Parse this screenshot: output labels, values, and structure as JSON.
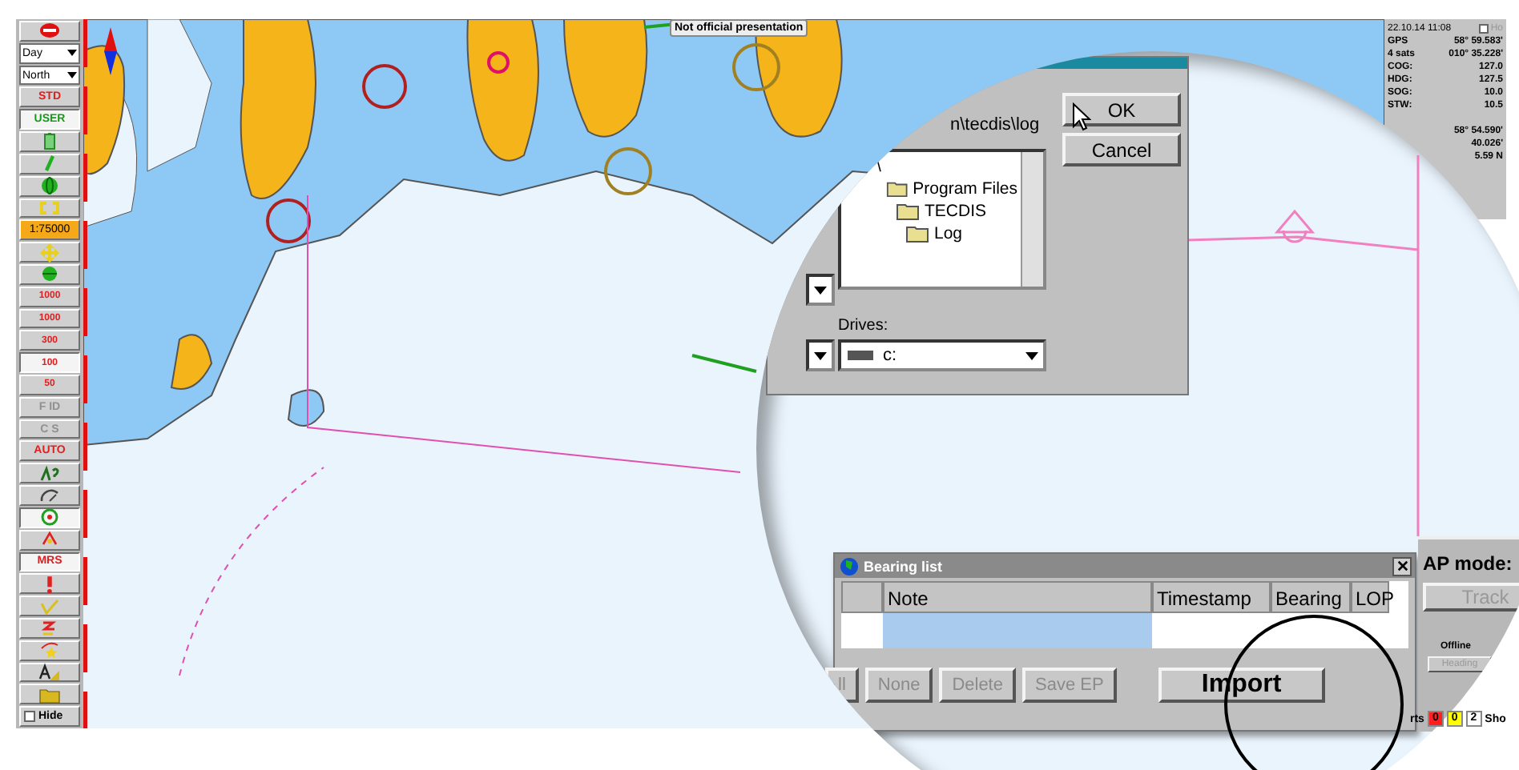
{
  "toolbar": {
    "items": [
      {
        "kind": "icon",
        "selected": false
      },
      {
        "kind": "select",
        "value": "Day",
        "selected": false
      },
      {
        "kind": "select",
        "value": "North",
        "selected": false
      },
      {
        "kind": "text",
        "label": "STD",
        "color": "#e02020",
        "selected": false
      },
      {
        "kind": "text",
        "label": "USER",
        "color": "#1a9a1a",
        "selected": true
      },
      {
        "kind": "icon",
        "selected": false
      },
      {
        "kind": "icon",
        "selected": false
      },
      {
        "kind": "icon",
        "selected": false
      },
      {
        "kind": "icon",
        "selected": false
      },
      {
        "kind": "scale",
        "label": "1:75000",
        "selected": false
      },
      {
        "kind": "icon",
        "selected": false
      },
      {
        "kind": "icon",
        "selected": false
      },
      {
        "kind": "tag",
        "label": "1000",
        "selected": false
      },
      {
        "kind": "tag",
        "label": "1000",
        "selected": false
      },
      {
        "kind": "tag",
        "label": "300",
        "selected": false
      },
      {
        "kind": "tag",
        "label": "100",
        "selected": true
      },
      {
        "kind": "tag",
        "label": "50",
        "selected": false
      },
      {
        "kind": "text",
        "label": "F ID",
        "color": "#909090",
        "selected": false
      },
      {
        "kind": "text",
        "label": "C S",
        "color": "#909090",
        "selected": false
      },
      {
        "kind": "text",
        "label": "AUTO",
        "color": "#e02020",
        "selected": false
      },
      {
        "kind": "icon",
        "selected": false
      },
      {
        "kind": "icon",
        "selected": false
      },
      {
        "kind": "icon",
        "selected": true
      },
      {
        "kind": "icon",
        "selected": false
      },
      {
        "kind": "text",
        "label": "MRS",
        "color": "#e02020",
        "selected": true
      },
      {
        "kind": "icon",
        "selected": false
      },
      {
        "kind": "icon",
        "selected": false
      },
      {
        "kind": "icon",
        "selected": false
      },
      {
        "kind": "icon",
        "selected": false
      },
      {
        "kind": "icon",
        "selected": false
      },
      {
        "kind": "icon",
        "selected": false
      }
    ],
    "hide": {
      "label": "Hide",
      "checked": false
    }
  },
  "chart": {
    "notice": "Not official presentation"
  },
  "nav_panel": {
    "datetime": "22.10.14  11:08",
    "hold": {
      "label": "Ho",
      "checked": false
    },
    "rows": [
      {
        "label": "GPS",
        "value": "58° 59.583'"
      },
      {
        "label": "4 sats",
        "value": "010° 35.228'"
      },
      {
        "label": "COG:",
        "value": "127.0"
      },
      {
        "label": "HDG:",
        "value": "127.5"
      },
      {
        "label": "SOG:",
        "value": "10.0"
      },
      {
        "label": "STW:",
        "value": "10.5"
      }
    ],
    "position": [
      "58° 54.590'",
      "40.026'",
      "5.59 N"
    ]
  },
  "magnifier": {
    "dialog": {
      "path": "n\\tecdis\\log",
      "folders": [
        {
          "name": "\\",
          "children": [
            {
              "name": "Program Files",
              "children": [
                {
                  "name": "TECDIS",
                  "children": [
                    {
                      "name": "Log"
                    }
                  ]
                }
              ]
            }
          ]
        }
      ],
      "ok": "OK",
      "cancel": "Cancel",
      "drives_label": "Drives:",
      "drive": "c:"
    },
    "bearing_list": {
      "title": "Bearing list",
      "columns": [
        "Note",
        "Timestamp",
        "Bearing",
        "LOP"
      ],
      "rows": [
        {
          "selected": true
        }
      ],
      "buttons": [
        {
          "label": "ll",
          "disabled": true
        },
        {
          "label": "None",
          "disabled": true
        },
        {
          "label": "Delete",
          "disabled": true
        },
        {
          "label": "Save EP",
          "disabled": true
        },
        {
          "label": "Import",
          "disabled": false
        }
      ]
    },
    "autopilot": {
      "label": "AP mode:",
      "mode": {
        "label": "Track",
        "disabled": true
      },
      "status": "Offline",
      "heading": {
        "label": "Heading",
        "disabled": true
      }
    }
  },
  "alerts": {
    "label": "rts",
    "counts": [
      {
        "value": "0",
        "color": "#ff2020"
      },
      {
        "value": "0",
        "color": "#ffff00"
      },
      {
        "value": "2",
        "color": "#ffffff"
      }
    ],
    "show": "Sho"
  }
}
